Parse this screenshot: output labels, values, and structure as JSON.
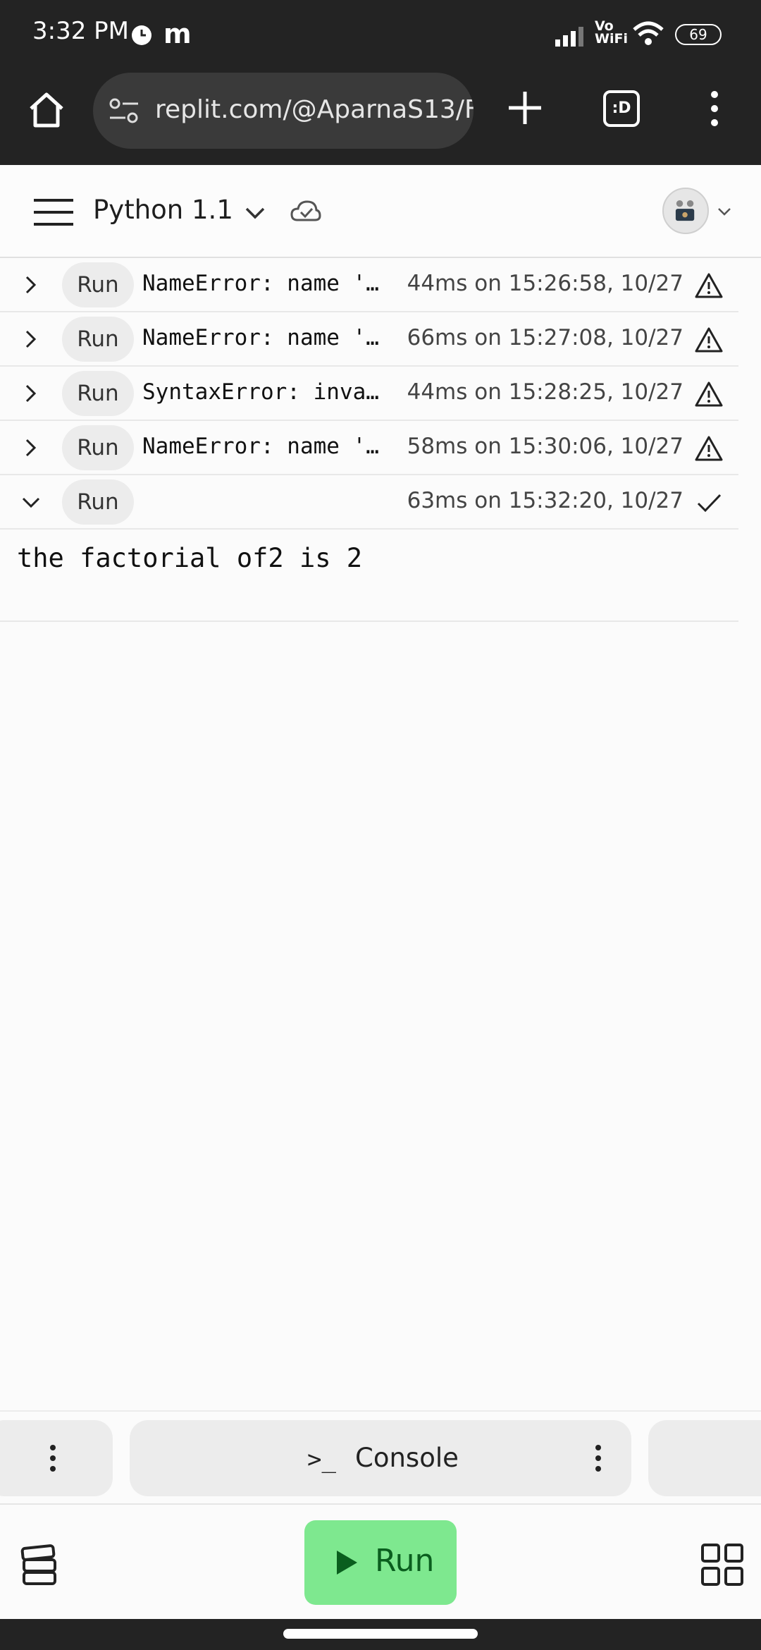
{
  "status_bar": {
    "time": "3:32 PM",
    "m_glyph": "m",
    "vowifi_top": "Vo",
    "vowifi_bottom": "WiFi",
    "battery": "69"
  },
  "browser": {
    "url": "replit.com/@AparnaS13/F",
    "tabs_label": ":D"
  },
  "header": {
    "repl_title": "Python 1.1"
  },
  "runs": [
    {
      "button": "Run",
      "error": "NameError: name '…",
      "meta": "44ms on 15:26:58, 10/27",
      "status": "warning-icon"
    },
    {
      "button": "Run",
      "error": "NameError: name '…",
      "meta": "66ms on 15:27:08, 10/27",
      "status": "warning-icon"
    },
    {
      "button": "Run",
      "error": "SyntaxError: inva…",
      "meta": "44ms on 15:28:25, 10/27",
      "status": "warning-icon"
    },
    {
      "button": "Run",
      "error": "NameError: name '…",
      "meta": "58ms on 15:30:06, 10/27",
      "status": "warning-icon"
    },
    {
      "button": "Run",
      "error": "",
      "meta": "63ms on 15:32:20, 10/27",
      "status": "check-icon"
    }
  ],
  "output": {
    "text": "the factorial of2 is 2"
  },
  "panels": {
    "console_icon": ">_",
    "console_label": "Console"
  },
  "bottom": {
    "run_label": "Run"
  },
  "colors": {
    "run_green": "#7ee88f",
    "run_text": "#0a5e1e",
    "chrome_dark": "#232323"
  }
}
